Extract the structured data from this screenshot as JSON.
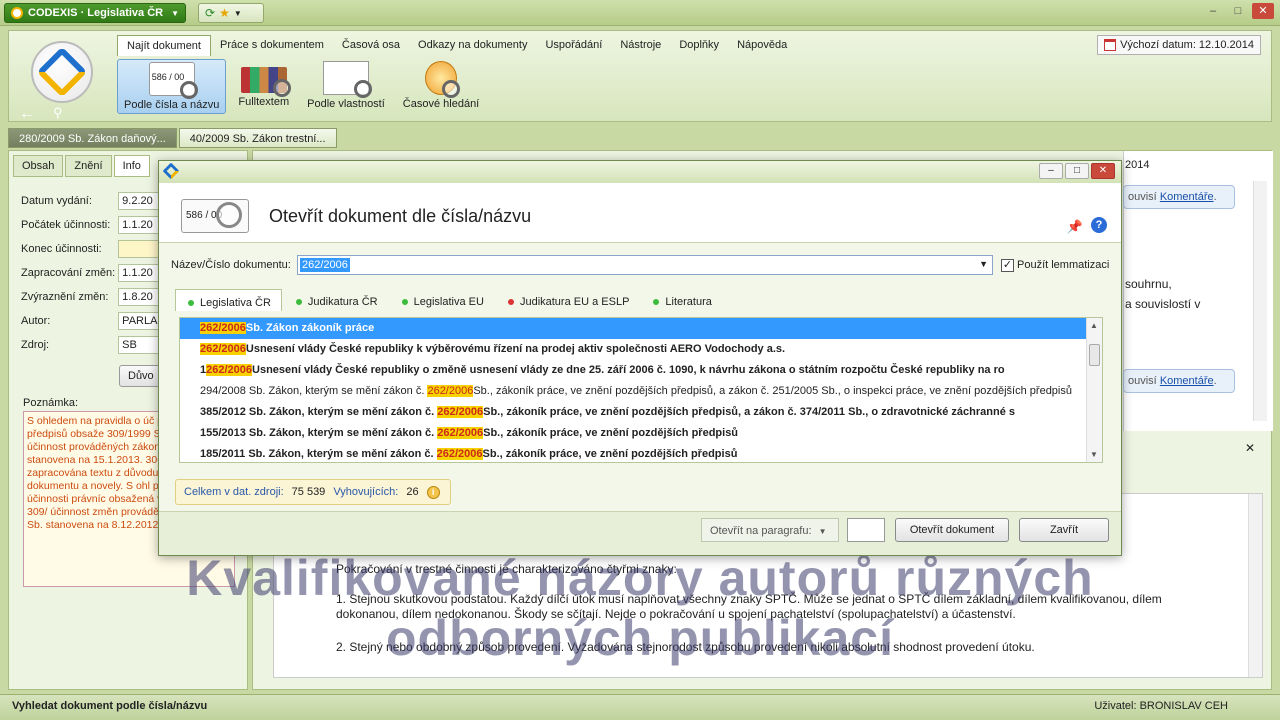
{
  "titlebar": {
    "app_title": "CODEXIS · Legislativa ČR",
    "window_buttons": [
      "–",
      "□",
      "✕"
    ]
  },
  "ribbon": {
    "menu": [
      "Najít dokument",
      "Práce s dokumentem",
      "Časová osa",
      "Odkazy na dokumenty",
      "Uspořádání",
      "Nástroje",
      "Doplňky",
      "Nápověda"
    ],
    "default_date_label": "Výchozí datum: 12.10.2014",
    "tools": [
      {
        "label": "Podle čísla a názvu",
        "icon": "number-search-icon"
      },
      {
        "label": "Fulltextem",
        "icon": "books-search-icon"
      },
      {
        "label": "Podle vlastností",
        "icon": "properties-search-icon"
      },
      {
        "label": "Časové hledání",
        "icon": "clock-search-icon"
      }
    ],
    "number_icon_text": "586 / 00"
  },
  "doc_tabs": [
    "280/2009 Sb. Zákon daňový...",
    "40/2009 Sb. Zákon trestní..."
  ],
  "left_panel": {
    "tabs": [
      "Obsah",
      "Znění",
      "Info"
    ],
    "fields": [
      {
        "label": "Datum vydání:",
        "value": "9.2.20"
      },
      {
        "label": "Počátek účinnosti:",
        "value": "1.1.20"
      },
      {
        "label": "Konec účinnosti:",
        "value": ""
      },
      {
        "label": "Zapracování změn:",
        "value": "1.1.20"
      },
      {
        "label": "Zvýraznění změn:",
        "value": "1.8.20"
      },
      {
        "label": "Autor:",
        "value": "PARLA"
      },
      {
        "label": "Zdroj:",
        "value": "SB"
      }
    ],
    "button": "Důvo",
    "note_label": "Poznámka:",
    "note_text": "S ohledem na pravidla o úč právních předpisů obsaže 309/1999 Sb. byla účinnost prováděných zákonem č. 4 stanovena na 15.1.2013. 306/2009 Sb. zapracována textu z důvodu shodnosti dokumentu a novely. S ohl pravidla o účinnosti právníc obsažená v zákoně č. 309/ účinnost změn prováděných 390/2012 Sb. stanovena na 8.12.2012."
  },
  "right_panel": {
    "year": "2014",
    "comment_text": "ouvisí",
    "comment_link": "Komentáře",
    "text_line1": "souhrnu,",
    "text_line2": "a souvislostí v",
    "paragraphs": [
      "Pokračování v trestné činnosti je charakterizováno čtyřmi znaky:",
      "1. Stejnou skutkovou podstatou. Každý dílčí útok musí naplňovat všechny znaky SPTČ. Může se jednat o SPTČ dílem základní, dílem kvalifikovanou, dílem dokonanou, dílem nedokonanou. Škody se sčítají. Nejde o pokračování u spojení pachatelství (spolupachatelství) a účastenství.",
      "2. Stejný nebo obdobný způsob provedení. Vyžadována stejnorodost způsobu provedení nikoli absolutní shodnost provedení útoku."
    ]
  },
  "overlay": {
    "line1": "Kvalifikované názory autorů různých",
    "line2": "odborných publikací"
  },
  "status": {
    "left": "Vyhledat dokument podle čísla/názvu",
    "right": "Uživatel: BRONISLAV CEH"
  },
  "dialog": {
    "title_buttons": [
      "–",
      "□",
      "✕"
    ],
    "heading": "Otevřít dokument dle čísla/názvu",
    "icon_text": "586 / 00",
    "search_label": "Název/Číslo dokumentu:",
    "search_value": "262/2006",
    "lemmatization_label": "Použít lemmatizaci",
    "lemmatization_checked": "✓",
    "categories": [
      {
        "label": "Legislativa ČR",
        "color": "#3dbb3d"
      },
      {
        "label": "Judikatura ČR",
        "color": "#3dbb3d"
      },
      {
        "label": "Legislativa EU",
        "color": "#3dbb3d"
      },
      {
        "label": "Judikatura EU a ESLP",
        "color": "#dd3333"
      },
      {
        "label": "Literatura",
        "color": "#3dbb3d"
      }
    ],
    "results": [
      {
        "pre": "",
        "hl": "262/2006",
        "post": "Sb. Zákon zákoník práce",
        "bold": true,
        "selected": true
      },
      {
        "pre": "",
        "hl": "262/2006",
        "post": "Usnesení vlády České republiky k výběrovému řízení na prodej aktiv společnosti AERO Vodochody a.s.",
        "bold": true,
        "selected": false
      },
      {
        "pre": "1",
        "hl": "262/2006",
        "post": "Usnesení vlády České republiky o změně usnesení vlády ze dne 25. září 2006 č. 1090, k návrhu zákona o státním      rozpočtu České republiky na ro",
        "bold": true,
        "selected": false
      },
      {
        "pre": "294/2008 Sb. Zákon, kterým se mění zákon č. ",
        "hl": "262/2006",
        "post": "Sb., zákoník práce, ve znění pozdějších předpisů, a zákon č. 251/2005 Sb., o inspekci práce, ve znění pozdějších předpisů",
        "bold": false,
        "selected": false
      },
      {
        "pre": "385/2012 Sb. Zákon, kterým se mění zákon č. ",
        "hl": "262/2006",
        "post": "Sb., zákoník práce, ve znění pozdějších předpisů, a zákon č. 374/2011 Sb., o zdravotnické záchranné s",
        "bold": true,
        "selected": false
      },
      {
        "pre": "155/2013 Sb. Zákon, kterým se mění zákon č. ",
        "hl": "262/2006",
        "post": "Sb., zákoník práce, ve znění pozdějších předpisů",
        "bold": true,
        "selected": false
      },
      {
        "pre": "185/2011 Sb. Zákon, kterým se mění zákon č. ",
        "hl": "262/2006",
        "post": "Sb., zákoník práce, ve znění pozdějších předpisů",
        "bold": true,
        "selected": false
      }
    ],
    "total_label": "Celkem v dat. zdroji:",
    "total_value": "75 539",
    "matching_label": "Vyhovujících:",
    "matching_value": "26",
    "open_on_para_label": "Otevřít na paragrafu:",
    "open_button": "Otevřít dokument",
    "close_button": "Zavřít"
  }
}
